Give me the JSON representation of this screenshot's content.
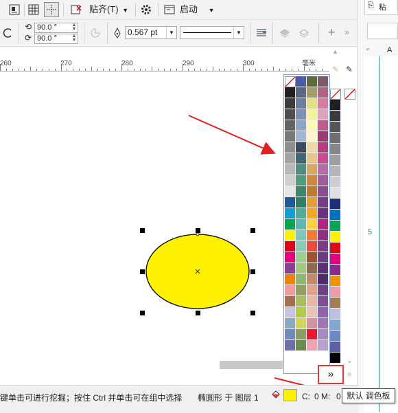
{
  "toolbar1": {
    "snap_label": "贴齐(T)",
    "launch_label": "启动"
  },
  "toolbar2": {
    "rotation_1": "90.0 °",
    "rotation_2": "90.0 °",
    "outline_width": "0.567 pt"
  },
  "ruler": {
    "ticks": [
      "260",
      "270",
      "280",
      "290",
      "300"
    ],
    "units": "毫米"
  },
  "right_panel": {
    "column_header": "A",
    "page_number": "5",
    "top_label": "粘"
  },
  "canvas": {
    "ellipse_fill": "#FFF200",
    "ellipse_stroke": "#000000"
  },
  "palette": {
    "columns": [
      [
        "none",
        "#231F20",
        "#3C3C3C",
        "#4E4E4E",
        "#636363",
        "#787878",
        "#8E8E8E",
        "#A3A3A3",
        "#B9B9B9",
        "#CFCFCF",
        "#E5E5E5",
        "#1D5A9A",
        "#0F9ED8",
        "#00A652",
        "#FFF200",
        "#E0001B",
        "#E6007E",
        "#8C3F96",
        "#F08300",
        "#F29C9F",
        "#A66E4E",
        "#C8C3DE",
        "#88A9C2",
        "#6F8BB9",
        "#6E6DAE"
      ],
      [
        "#4B5BA6",
        "#5C6780",
        "#6D7EA0",
        "#7C8FB6",
        "#8EA4C4",
        "#A2B7D4",
        "#3D4A5E",
        "#3E6572",
        "#4E8C86",
        "#4F9D7E",
        "#3A866C",
        "#2F7F62",
        "#4CAF9A",
        "#5CB7B0",
        "#7FC6BD",
        "#8ACBB3",
        "#9BCF91",
        "#A2C97F",
        "#8FB873",
        "#90A35D",
        "#A9BF5A",
        "#B7CA47",
        "#D2D65A",
        "#8A9F62",
        "#6B8C4E"
      ],
      [
        "#5E6B3A",
        "#A59D6B",
        "#E5E17D",
        "#F7F497",
        "#FFF8B3",
        "#FFF5CC",
        "#EFD9A5",
        "#E7C58B",
        "#DBA760",
        "#CE8A3C",
        "#C27A2E",
        "#E69E3A",
        "#F5A623",
        "#FFD23F",
        "#F47A36",
        "#E84C3D",
        "#A0522D",
        "#8E6A4C",
        "#C48A6A",
        "#E1A48A",
        "#E8B7A5",
        "#EBC2B6",
        "#D4949E",
        "#E8182E",
        "#F3A2B0"
      ],
      [
        "#7C5A6E",
        "#B06385",
        "#D87AA2",
        "#E3A1C0",
        "#C05A8F",
        "#9B3A73",
        "#B83B7E",
        "#CC4A94",
        "#B76AA8",
        "#A05C9A",
        "#8A4E8E",
        "#743C86",
        "#6A2F80",
        "#B12684",
        "#8F2F84",
        "#7A3B8A",
        "#6D3A88",
        "#5A2F78",
        "#4E2A70",
        "#6E3E8A",
        "#7E4E9A",
        "#8E62AE",
        "#9C76B9",
        "#A88AC4",
        "#B8A0D0"
      ],
      [
        "none",
        "#1F1F1F",
        "#3A3A3A",
        "#565656",
        "#6E6E6E",
        "#868686",
        "#9E9E9E",
        "#B6B6B6",
        "#CECECE",
        "#E0E0E0",
        "#1D2F7A",
        "#0070C0",
        "#00A650",
        "#FFF200",
        "#E30613",
        "#E5007D",
        "#8B2A8C",
        "#F39200",
        "#EE9CA7",
        "#A67C52",
        "#C0BFE0",
        "#7FA7D0",
        "#6C89C6",
        "#5C5EA8",
        "#000000"
      ]
    ]
  },
  "statusbar": {
    "hint": "键单击可进行挖掘；按住 Ctrl 并单击可在组中选择",
    "object_info": "椭圆形 于 图层 1",
    "fill_color": "#FFF200",
    "c_label": "C:",
    "m_label": "0 M:",
    "m_value": "0"
  },
  "tooltip": {
    "text": "默认 调色板"
  }
}
